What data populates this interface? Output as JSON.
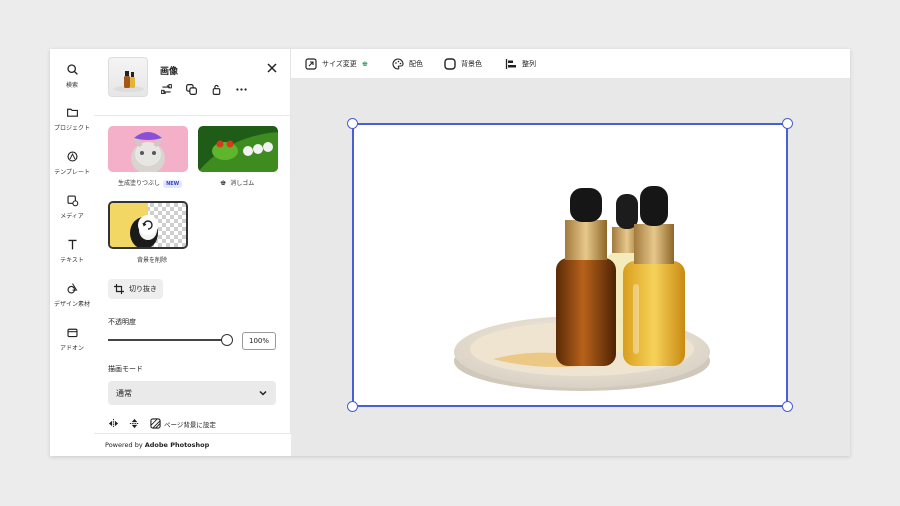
{
  "rail": {
    "items": [
      {
        "label": "検索",
        "icon": "search-icon"
      },
      {
        "label": "プロジェクト",
        "icon": "folder-icon"
      },
      {
        "label": "テンプレート",
        "icon": "template-icon"
      },
      {
        "label": "メディア",
        "icon": "media-icon"
      },
      {
        "label": "テキスト",
        "icon": "text-icon"
      },
      {
        "label": "デザイン素材",
        "icon": "design-assets-icon"
      },
      {
        "label": "アドオン",
        "icon": "addon-icon"
      }
    ]
  },
  "panel": {
    "title": "画像",
    "cards": {
      "generative_fill": {
        "label": "生成塗りつぶし",
        "badge": "NEW"
      },
      "eraser": {
        "label": "消しゴム"
      },
      "remove_bg": {
        "label": "背景を削除"
      }
    },
    "crop_label": "切り抜き",
    "opacity_label": "不透明度",
    "opacity_value": "100%",
    "opacity_level": 1.0,
    "blend_label": "描画モード",
    "blend_value": "通常",
    "page_bg_label": "ページ背景に設定",
    "powered_prefix": "Powered by ",
    "powered_brand": "Adobe Photoshop"
  },
  "toolbar": {
    "resize": "サイズ変更",
    "color": "配色",
    "bg_color": "背景色",
    "align": "整列"
  },
  "colors": {
    "selection": "#4a5fd1",
    "badge_text": "#3b47c8",
    "badge_bg": "#e3e6ff"
  }
}
